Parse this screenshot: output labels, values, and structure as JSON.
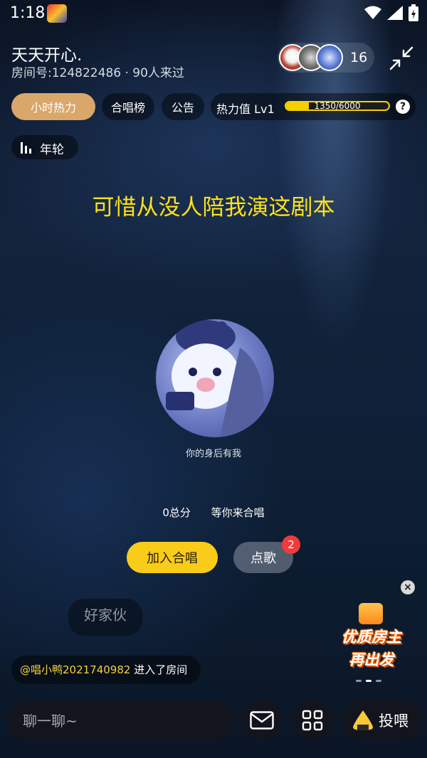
{
  "status": {
    "time": "1:18"
  },
  "header": {
    "room_name": "天天开心.",
    "room_meta": "房间号:124822486 · 90人来过",
    "audience_count": "16"
  },
  "chips": {
    "hot": "小时热力",
    "chorus": "合唱榜",
    "notice": "公告",
    "heat_label": "热力值 Lv1",
    "heat_progress": "1350/6000",
    "heat_fraction": 0.225,
    "help": "?"
  },
  "rings": {
    "label": "年轮"
  },
  "lyric": "可惜从没人陪我演这剧本",
  "singer": {
    "name": "你的身后有我"
  },
  "score": {
    "points": "0总分",
    "status": "等你来合唱"
  },
  "actions": {
    "join": "加入合唱",
    "song": "点歌",
    "song_badge": "2"
  },
  "float_message": "好家伙",
  "promo": {
    "line1": "优质房主",
    "line2": "再出发",
    "close": "×"
  },
  "enter_message": {
    "user": "@唱小鸭2021740982",
    "text": " 进入了房间"
  },
  "bottom": {
    "chat_placeholder": "聊一聊~",
    "feed": "投喂"
  },
  "colors": {
    "accent_yellow": "#f8cc19",
    "lyric_yellow": "#ffe11a",
    "hot_chip": "#d9a76a",
    "badge_red": "#ee3b3b"
  }
}
